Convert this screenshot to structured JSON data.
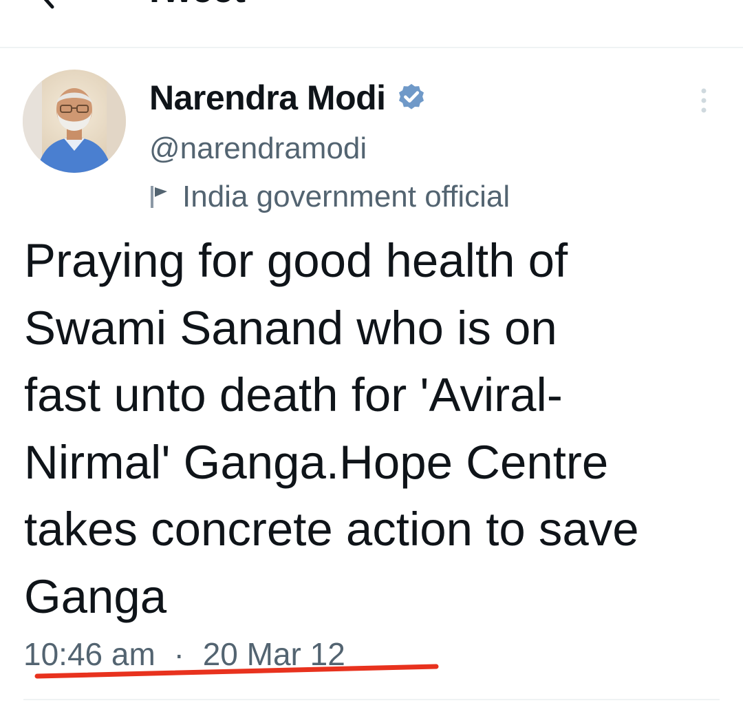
{
  "header": {
    "title": "Tweet",
    "back_icon": "arrow-left-icon"
  },
  "author": {
    "display_name": "Narendra Modi",
    "handle": "@narendramodi",
    "verified_icon": "verified-badge-icon",
    "affiliation_icon": "flag-icon",
    "affiliation_label": "India government official",
    "more_icon": "more-vertical-icon"
  },
  "tweet": {
    "lines": [
      "Praying for good health of",
      "Swami Sanand who is on",
      "fast unto death for 'Aviral-",
      "Nirmal' Ganga.Hope Centre",
      "takes concrete action to save",
      "Ganga"
    ],
    "time": "10:46 am",
    "separator": "·",
    "date": "20 Mar 12"
  },
  "colors": {
    "text_primary": "#0f1419",
    "text_secondary": "#536471",
    "verified_blue": "#6f99c8",
    "annotation_red": "#e8321e",
    "divider": "#eff3f4"
  }
}
